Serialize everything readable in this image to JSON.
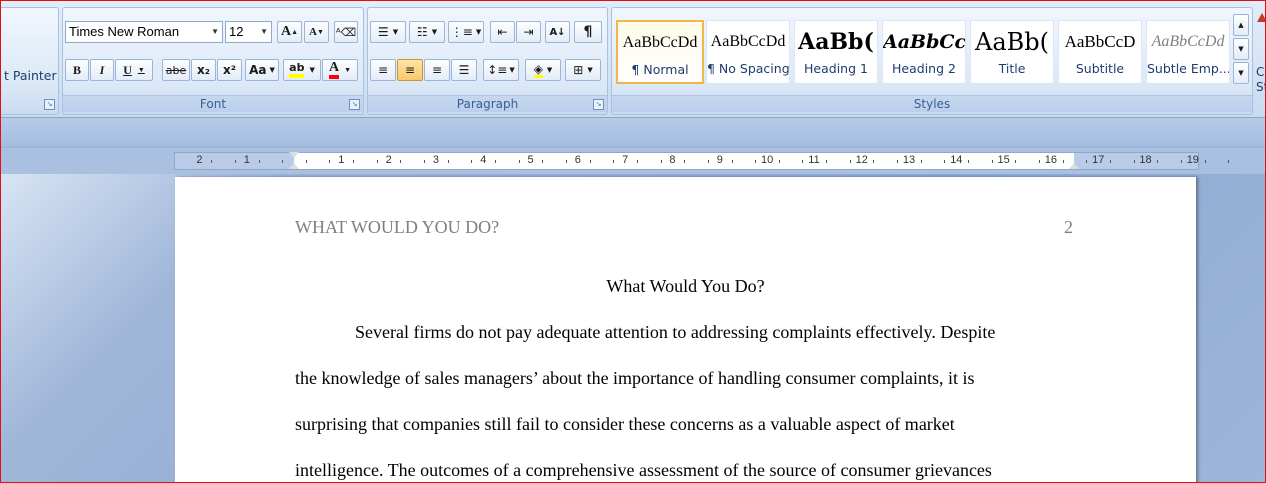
{
  "clipboard": {
    "format_painter_label": "t Painter"
  },
  "font_group": {
    "label": "Font",
    "font_name": "Times New Roman",
    "font_size": "12",
    "grow_label": "A",
    "shrink_label": "A",
    "bold": "B",
    "italic": "I",
    "underline": "U",
    "strikethrough": "abe",
    "subscript": "x₂",
    "superscript": "x²",
    "change_case": "Aa",
    "highlight": "ab",
    "font_color": "A",
    "highlight_color": "#ffff00",
    "font_color_value": "#ff0000"
  },
  "paragraph_group": {
    "label": "Paragraph",
    "sort_label": "A↓",
    "pilcrow": "¶"
  },
  "styles_group": {
    "label": "Styles",
    "items": [
      {
        "sample": "AaBbCcDd",
        "name": "¶ Normal"
      },
      {
        "sample": "AaBbCcDd",
        "name": "¶ No Spacing"
      },
      {
        "sample": "AaBb(",
        "name": "Heading 1"
      },
      {
        "sample": "AaBbCc",
        "name": "Heading 2"
      },
      {
        "sample": "AaBb(",
        "name": "Title"
      },
      {
        "sample": "AaBbCcD",
        "name": "Subtitle"
      },
      {
        "sample": "AaBbCcDd",
        "name": "Subtle Emp..."
      }
    ],
    "change_styles_partial_1": "Cl",
    "change_styles_partial_2": "St"
  },
  "ruler": {
    "left_numbers": [
      "2",
      "1"
    ],
    "right_numbers": [
      "1",
      "2",
      "3",
      "4",
      "5",
      "6",
      "7",
      "8",
      "9",
      "10",
      "11",
      "12",
      "13",
      "14",
      "15",
      "16",
      "17",
      "18",
      "19"
    ]
  },
  "document": {
    "header_title": "WHAT WOULD YOU DO?",
    "page_number": "2",
    "title": "What Would You Do?",
    "lines": [
      "Several firms do not pay adequate attention to addressing complaints effectively. Despite",
      "the knowledge of sales managers’ about the importance of handling consumer complaints, it is",
      "surprising that companies still fail to consider these concerns as a valuable aspect of market",
      "intelligence. The outcomes of a comprehensive assessment of the source of consumer grievances"
    ]
  }
}
